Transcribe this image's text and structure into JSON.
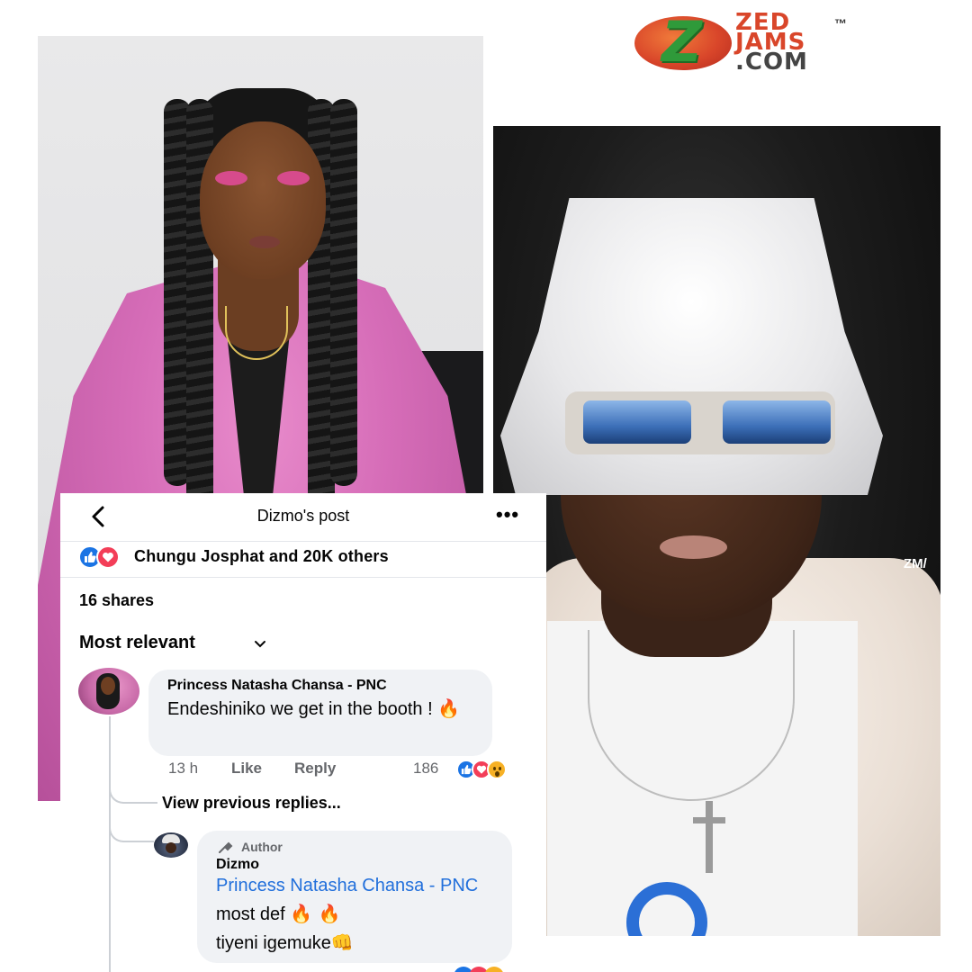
{
  "logo": {
    "brand_line1": "ZED",
    "brand_line2": "JAMS",
    "brand_line3": ".COM",
    "trademark": "™"
  },
  "photos": {
    "right_watermark": "ZM/"
  },
  "post": {
    "title": "Dizmo's post",
    "more_label": "•••",
    "reactions_text": "Chungu Josphat and 20K others",
    "shares_text": "16 shares",
    "sort_label": "Most relevant"
  },
  "comment": {
    "author": "Princess Natasha Chansa - PNC",
    "text": "Endeshiniko we get in the booth ! ",
    "emoji": "🔥",
    "time": "13 h",
    "like_label": "Like",
    "reply_label": "Reply",
    "reaction_count": "186"
  },
  "replies": {
    "view_previous_label": "View previous replies...",
    "reply": {
      "badge_label": "Author",
      "author": "Dizmo",
      "mention": "Princess Natasha Chansa - PNC",
      "text": " most def ",
      "emoji_fire": "🔥 🔥",
      "text2": "tiyeni igemuke",
      "emoji_fist": "👊"
    }
  },
  "colors": {
    "facebook_blue": "#1b74e4",
    "love_red": "#f33e58",
    "mention_blue": "#216fdb",
    "jacket_pink": "#d66db8"
  },
  "icons": [
    "back-arrow-icon",
    "more-icon",
    "like-reaction-icon",
    "love-reaction-icon",
    "wow-reaction-icon",
    "chevron-down-icon",
    "mic-icon"
  ]
}
